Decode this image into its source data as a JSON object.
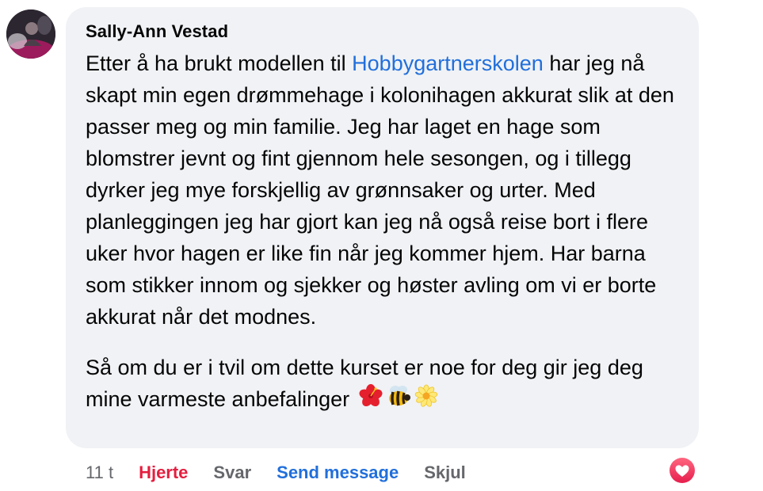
{
  "comment": {
    "author": "Sally-Ann Vestad",
    "paragraph1": {
      "before_link": "Etter å ha brukt modellen til ",
      "link": "Hobbygartnerskolen",
      "after_link": " har jeg nå skapt min egen drømmehage i kolonihagen akkurat slik at den passer meg og min familie. Jeg har laget en hage som blomstrer jevnt og fint gjennom hele sesongen, og i tillegg dyrker jeg mye forskjellig av grønnsaker og urter. Med planleggingen jeg har gjort kan jeg nå også reise bort i flere uker hvor hagen er like fin når jeg kommer hjem. Har barna som stikker innom og sjekker og høster avling om vi er borte akkurat når det modnes."
    },
    "paragraph2": "Så om du er i tvil om dette kurset er noe for deg gir jeg deg mine varmeste anbefalinger ",
    "emojis": [
      "hibiscus-icon",
      "bee-icon",
      "daisy-icon"
    ]
  },
  "actions": {
    "time": "11 t",
    "heart": "Hjerte",
    "reply": "Svar",
    "send_message": "Send message",
    "hide": "Skjul"
  },
  "reaction": {
    "icon": "heart-reaction-icon"
  },
  "colors": {
    "bubble": "#f0f2f5",
    "link": "#216fdb",
    "heart": "#e41e3f",
    "muted": "#65676b"
  }
}
